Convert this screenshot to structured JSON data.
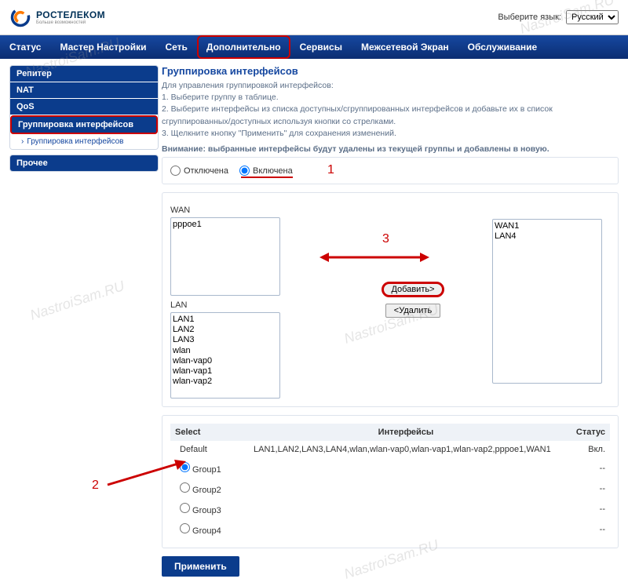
{
  "lang": {
    "label": "Выберите язык:",
    "value": "Русский"
  },
  "brand": {
    "name": "РОСТЕЛЕКОМ",
    "tagline": "Больше возможностей"
  },
  "nav": [
    "Статус",
    "Мастер Настройки",
    "Сеть",
    "Дополнительно",
    "Сервисы",
    "Межсетевой Экран",
    "Обслуживание"
  ],
  "nav_active": 3,
  "sidebar": {
    "items": [
      "Репитер",
      "NAT",
      "QoS",
      "Группировка интерфейсов"
    ],
    "sub": "Группировка интерфейсов",
    "other": "Прочее"
  },
  "page": {
    "title": "Группировка интерфейсов",
    "intro": "Для управления группировкой интерфейсов:\n1. Выберите группу в таблице.\n2. Выберите интерфейсы из списка доступных/сгруппированных интерфейсов и добавьте их в список сгруппированных/доступных используя кнопки со стрелками.\n3. Щелкните кнопку \"Применить\" для сохранения изменений.",
    "warn": "Внимание: выбранные интерфейсы будут удалены из текущей группы и добавлены в новую."
  },
  "toggle": {
    "off": "Отключена",
    "on": "Включена",
    "value": "on"
  },
  "labels": {
    "wan": "WAN",
    "lan": "LAN"
  },
  "lists": {
    "wan": [
      "pppoe1"
    ],
    "lan": [
      "LAN1",
      "LAN2",
      "LAN3",
      "wlan",
      "wlan-vap0",
      "wlan-vap1",
      "wlan-vap2"
    ],
    "grouped": [
      "WAN1",
      "LAN4"
    ]
  },
  "buttons": {
    "add": "Добавить>",
    "remove": "<Удалить",
    "apply": "Применить"
  },
  "table": {
    "headers": [
      "Select",
      "Интерфейсы",
      "Статус"
    ],
    "rows": [
      {
        "select": "Default",
        "radio": false,
        "ifaces": "LAN1,LAN2,LAN3,LAN4,wlan,wlan-vap0,wlan-vap1,wlan-vap2,pppoe1,WAN1",
        "status": "Вкл."
      },
      {
        "select": "Group1",
        "radio": true,
        "checked": true,
        "ifaces": "",
        "status": "--"
      },
      {
        "select": "Group2",
        "radio": true,
        "checked": false,
        "ifaces": "",
        "status": "--"
      },
      {
        "select": "Group3",
        "radio": true,
        "checked": false,
        "ifaces": "",
        "status": "--"
      },
      {
        "select": "Group4",
        "radio": true,
        "checked": false,
        "ifaces": "",
        "status": "--"
      }
    ]
  },
  "annotations": {
    "a1": "1",
    "a2": "2",
    "a3": "3"
  },
  "watermark": "NastroiSam.RU"
}
